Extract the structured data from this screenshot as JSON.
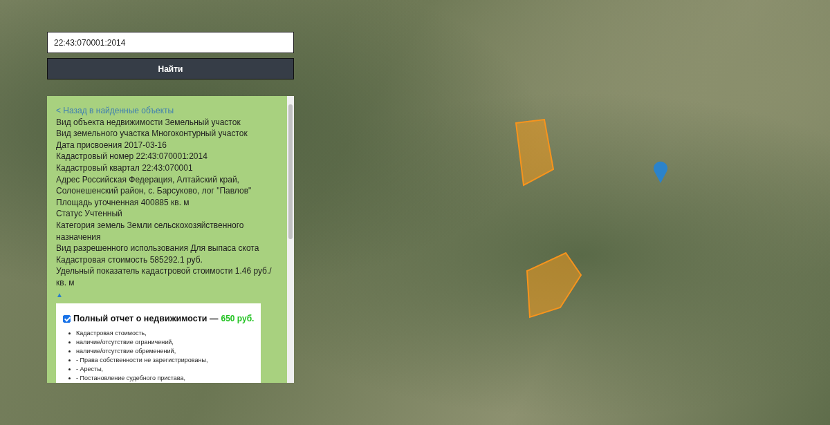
{
  "search": {
    "value": "22:43:070001:2014",
    "button": "Найти"
  },
  "details": {
    "back_link": "< Назад в найденные объекты",
    "lines": [
      "Вид объекта недвижимости Земельный участок",
      "Вид земельного участка Многоконтурный участок",
      "Дата присвоения 2017-03-16",
      "Кадастровый номер 22:43:070001:2014",
      "Кадастровый квартал 22:43:070001",
      "Адрес Российская Федерация, Алтайский край, Солонешенский район, с. Барсуково, лог \"Павлов\"",
      "Площадь уточненная 400885 кв. м",
      "Статус Учтенный",
      "Категория земель Земли сельскохозяйственного назначения",
      "Вид разрешенного использования Для выпаса скота",
      "Кадастровая стоимость 585292.1 руб.",
      "Удельный показатель кадастровой стоимости 1.46 руб./кв. м"
    ],
    "collapse": "▲"
  },
  "report": {
    "checked": true,
    "title": "Полный отчет о недвижимости —",
    "price": "650 руб.",
    "items": [
      "Кадастровая стоимость,",
      "наличие/отсутствие ограничений,",
      "наличие/отсутствие обременений,",
      "- Права собственности не зарегистрированы,",
      "- Аресты,",
      "- Постановление судебного пристава,"
    ]
  }
}
